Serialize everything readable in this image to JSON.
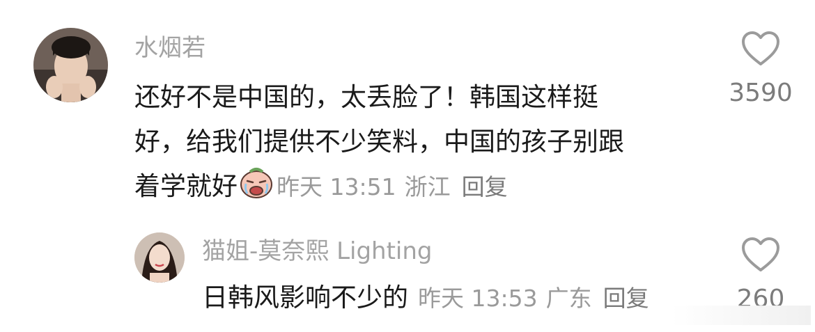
{
  "comments": [
    {
      "username": "水烟若",
      "lines": [
        "还好不是中国的，太丢脸了！韩国这样挺",
        "好，给我们提供不少笑料，中国的孩子别跟",
        "着学就好"
      ],
      "emoji_icon": "crying-face-emoji-icon",
      "date": "昨天 13:51",
      "location": "浙江",
      "reply_label": "回复",
      "like_count": "3590"
    },
    {
      "username": "猫姐-莫奈熙 Lighting",
      "text": "日韩风影响不少的",
      "date": "昨天 13:53",
      "location": "广东",
      "reply_label": "回复",
      "like_count": "260"
    }
  ]
}
